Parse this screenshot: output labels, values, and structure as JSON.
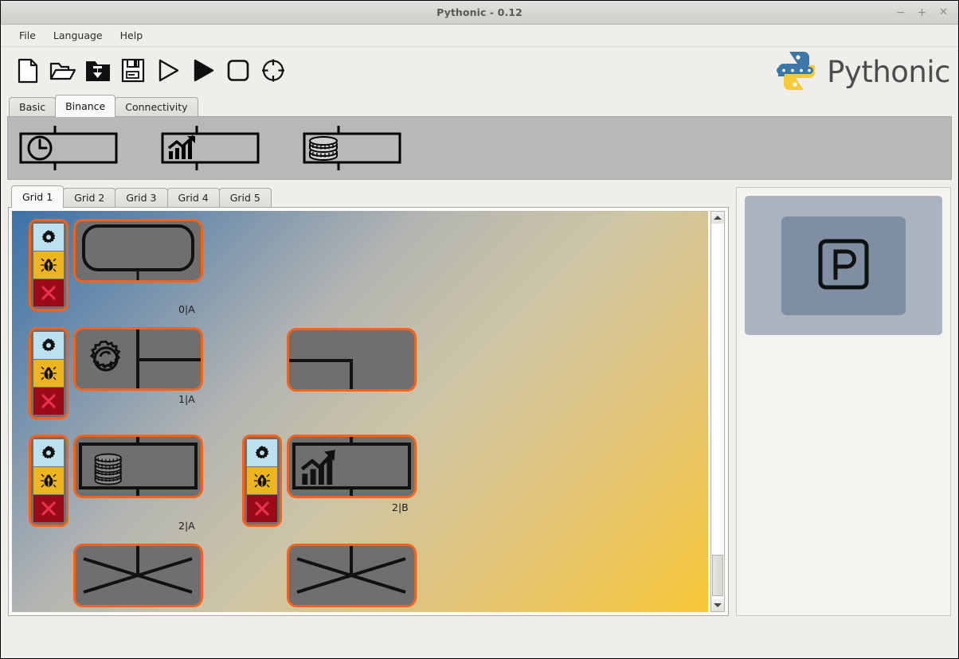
{
  "window": {
    "title": "Pythonic - 0.12",
    "controls": [
      {
        "name": "minimize",
        "glyph": "−"
      },
      {
        "name": "maximize",
        "glyph": "+"
      },
      {
        "name": "close",
        "glyph": "✕"
      }
    ]
  },
  "menubar": {
    "items": [
      {
        "label": "File"
      },
      {
        "label": "Language"
      },
      {
        "label": "Help"
      }
    ]
  },
  "toolbar": {
    "buttons": [
      {
        "name": "new-file-icon",
        "title": "New"
      },
      {
        "name": "open-folder-icon",
        "title": "Open"
      },
      {
        "name": "load-folder-icon",
        "title": "Load"
      },
      {
        "name": "save-floppy-icon",
        "title": "Save"
      },
      {
        "name": "play-outline-icon",
        "title": "Start"
      },
      {
        "name": "play-filled-icon",
        "title": "Run"
      },
      {
        "name": "stop-square-icon",
        "title": "Stop"
      },
      {
        "name": "target-crosshair-icon",
        "title": "Reset"
      }
    ],
    "logo_text": "Pythonic",
    "logo_colors": {
      "top": "#3c77a8",
      "bottom": "#f5cb3c"
    }
  },
  "element_tabs": {
    "tabs": [
      {
        "label": "Basic",
        "active": false
      },
      {
        "label": "Binance",
        "active": true
      },
      {
        "label": "Connectivity",
        "active": false
      }
    ],
    "palette": [
      {
        "name": "palette-item-clock",
        "icon": "clock-icon"
      },
      {
        "name": "palette-item-chart",
        "icon": "trend-chart-icon"
      },
      {
        "name": "palette-item-coins",
        "icon": "coin-stack-icon"
      }
    ],
    "palette_bg": "#b8b8b8"
  },
  "grid_tabs": {
    "tabs": [
      {
        "label": "Grid 1",
        "active": true
      },
      {
        "label": "Grid 2",
        "active": false
      },
      {
        "label": "Grid 3",
        "active": false
      },
      {
        "label": "Grid 4",
        "active": false
      },
      {
        "label": "Grid 5",
        "active": false
      }
    ]
  },
  "canvas": {
    "gradient_from": "#3b72a8",
    "gradient_to": "#f6c636",
    "accent": "#f4631e",
    "node_fill": "#6f6f6f",
    "toolbox_buttons": [
      {
        "name": "config-gear-button",
        "bg": "#bde0ee"
      },
      {
        "name": "debug-bug-button",
        "bg": "#eeb51f"
      },
      {
        "name": "delete-x-button",
        "bg": "#9b0a17"
      }
    ],
    "nodes": [
      {
        "id": "n0a",
        "label": "0|A",
        "icon": "start-capsule-icon",
        "has_toolbox": true
      },
      {
        "id": "n1a",
        "label": "1|A",
        "icon": "process-gear-icon",
        "has_toolbox": true
      },
      {
        "id": "n1b",
        "label": "",
        "icon": "corner-connector-icon",
        "has_toolbox": false
      },
      {
        "id": "n2a",
        "label": "2|A",
        "icon": "coin-stack-icon",
        "has_toolbox": true
      },
      {
        "id": "n2b",
        "label": "2|B",
        "icon": "trend-chart-icon",
        "has_toolbox": true
      },
      {
        "id": "n3a",
        "label": "",
        "icon": "branch-cross-icon",
        "has_toolbox": false
      },
      {
        "id": "n3b",
        "label": "",
        "icon": "branch-cross-icon",
        "has_toolbox": false
      }
    ],
    "scrollbar": {
      "up": "▲",
      "down": "▼"
    }
  },
  "right_panel": {
    "card_icon": "parking-p-icon",
    "card_bg": "#aab4c0",
    "inner_bg": "#7f8fa1"
  }
}
